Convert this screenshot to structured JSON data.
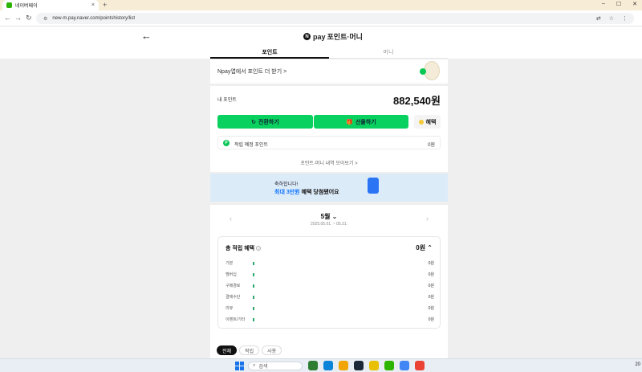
{
  "browser": {
    "tab_title": "네이버페이",
    "new_tab": "+",
    "url": "new-m.pay.naver.com/pointshistory/list",
    "window_controls": [
      "–",
      "☐",
      "✕"
    ]
  },
  "header": {
    "back": "←",
    "brand_mark": "N",
    "brand_pay": "pay",
    "brand_title": "포인트·머니",
    "tabs": [
      {
        "label": "포인트",
        "active": true
      },
      {
        "label": "머니",
        "active": false
      }
    ]
  },
  "promo": {
    "text": "Npay앱에서 포인트 더 받기 >"
  },
  "points": {
    "label": "내 포인트",
    "amount": "882,540원",
    "buttons": {
      "convert": "전환하기",
      "gift": "선물하기",
      "benefit": "혜택"
    },
    "pending_label": "적립 예정 포인트",
    "pending_value": "0원",
    "more_link": "포인트·머니 내역 모아보기 >"
  },
  "banner": {
    "line1": "축하합니다!",
    "line2_highlight": "최대 3만원",
    "line2_rest": " 혜택 당첨됐어요"
  },
  "month": {
    "title": "5월",
    "range": "2025.05.01. ~ 05.31.",
    "prev": "‹",
    "next": "›"
  },
  "summary": {
    "title": "총 적립 혜택",
    "help": "?",
    "total": "0원",
    "toggle": "⌃",
    "rows": [
      {
        "label": "기본",
        "value": "0원"
      },
      {
        "label": "멤버십",
        "value": "0원"
      },
      {
        "label": "구매경로",
        "value": "0원"
      },
      {
        "label": "결제수단",
        "value": "0원"
      },
      {
        "label": "리뷰",
        "value": "0원"
      },
      {
        "label": "이벤트/기타",
        "value": "0원"
      }
    ]
  },
  "filters": [
    {
      "label": "전체",
      "active": true
    },
    {
      "label": "적립",
      "active": false
    },
    {
      "label": "사용",
      "active": false
    }
  ],
  "taskbar": {
    "search_placeholder": "검색",
    "clock": "20",
    "app_colors": [
      "#2f7d32",
      "#0a84d8",
      "#f0a500",
      "#1b2838",
      "#e8c000",
      "#2db400",
      "#4285f4",
      "#ea4335"
    ]
  }
}
